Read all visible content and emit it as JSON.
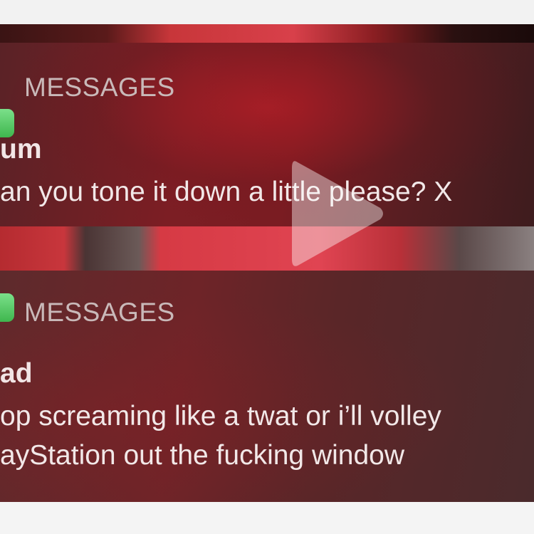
{
  "notifications": [
    {
      "app": "MESSAGES",
      "sender": "um",
      "lines": [
        "an you tone it down a little please? X"
      ]
    },
    {
      "app": "MESSAGES",
      "sender": "ad",
      "lines": [
        "op screaming like a twat or i’ll volley",
        "ayStation out the fucking window"
      ]
    }
  ],
  "video": {
    "play_icon": "play-icon"
  },
  "colors": {
    "messages_green": "#4cc35a",
    "notification_red": "#7a1c22"
  }
}
